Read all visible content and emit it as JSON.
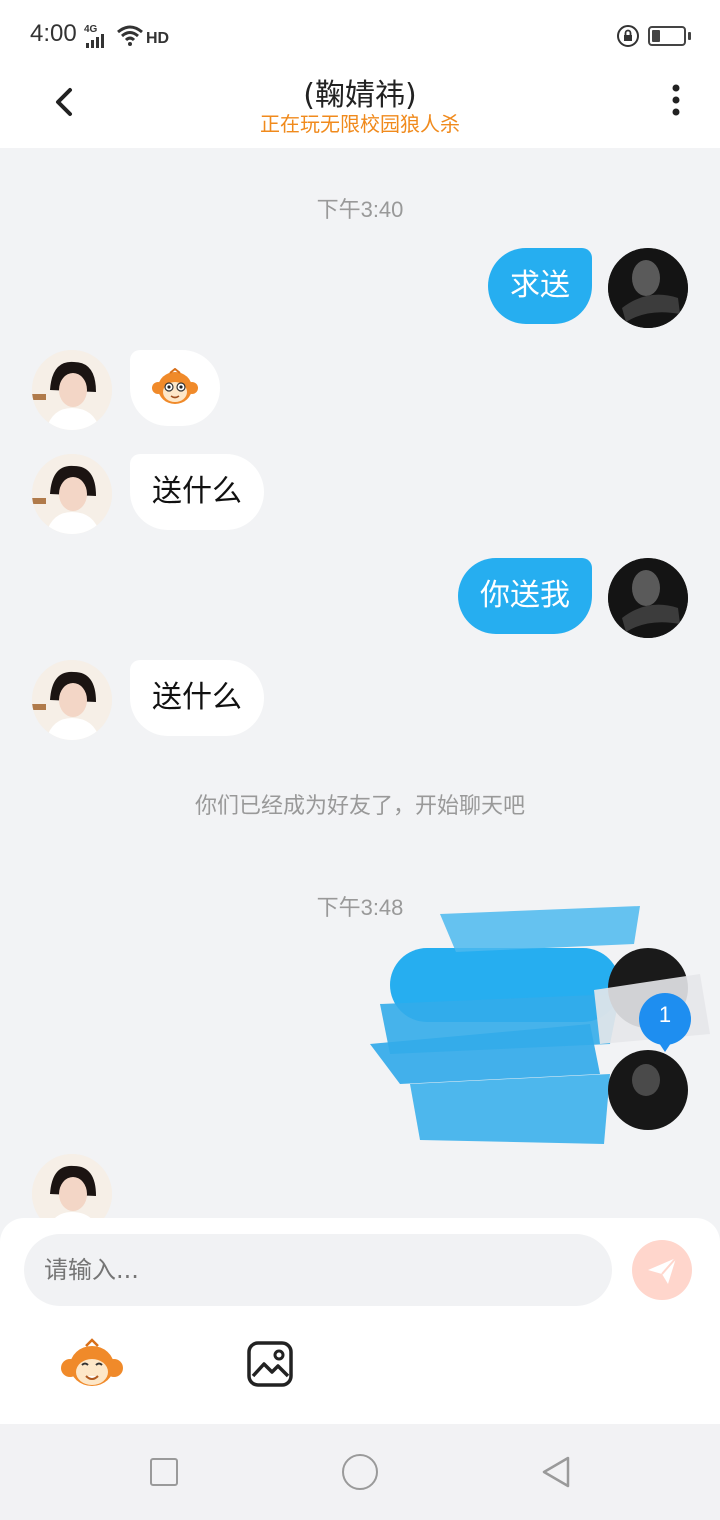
{
  "status_bar": {
    "time": "4:00",
    "network": "4G",
    "hd": "HD",
    "icons": [
      "signal-icon",
      "wifi-icon",
      "rotation-lock-icon",
      "battery-icon"
    ]
  },
  "header": {
    "title": "(鞠婧祎)",
    "subtitle": "正在玩无限校园狼人杀",
    "icons": [
      "back-arrow-icon",
      "more-vertical-icon"
    ]
  },
  "chat": {
    "time_1": "下午3:40",
    "messages": [
      {
        "sender": "self",
        "text": "求送"
      },
      {
        "sender": "other",
        "text": "",
        "sticker": "monkey-face-icon"
      },
      {
        "sender": "other",
        "text": "送什么"
      },
      {
        "sender": "self",
        "text": "你送我"
      },
      {
        "sender": "other",
        "text": "送什么"
      }
    ],
    "system_note": "你们已经成为好友了，开始聊天吧",
    "time_2": "下午3:48",
    "hidden_message": {
      "sender": "self",
      "text": "",
      "obscured": true
    },
    "unread_count": "1"
  },
  "input": {
    "placeholder": "请输入...",
    "icons": [
      "send-icon",
      "monkey-emoji-icon",
      "image-icon"
    ]
  },
  "colors": {
    "self_bubble": "#26aef0",
    "subtitle": "#f08a1c",
    "badge": "#1e8ef0",
    "send_button": "#ffd6cc"
  },
  "system_nav": {
    "icons": [
      "recent-apps-icon",
      "home-icon",
      "back-triangle-icon"
    ]
  }
}
